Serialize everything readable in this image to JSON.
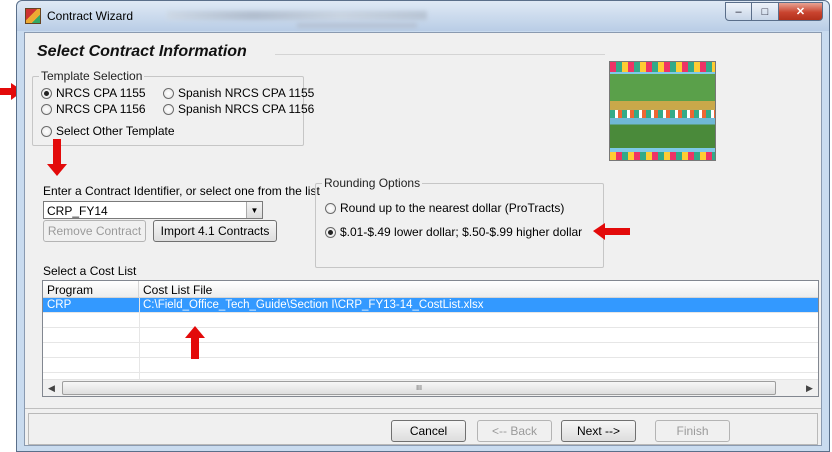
{
  "window": {
    "title": "Contract Wizard",
    "buttons": {
      "minimize": "–",
      "maximize": "□",
      "close": "✕"
    }
  },
  "page": {
    "heading": "Select Contract Information"
  },
  "template_selection": {
    "legend": "Template Selection",
    "options": [
      {
        "label": "NRCS CPA 1155",
        "selected": true
      },
      {
        "label": "Spanish NRCS CPA 1155",
        "selected": false
      },
      {
        "label": "NRCS CPA 1156",
        "selected": false
      },
      {
        "label": "Spanish NRCS CPA 1156",
        "selected": false
      },
      {
        "label": "Select Other Template",
        "selected": false
      }
    ]
  },
  "contract": {
    "prompt": "Enter a Contract Identifier, or select one from the list",
    "value": "CRP_FY14",
    "dropdown_icon": "chevron-down-icon",
    "remove_label": "Remove Contract",
    "import_label": "Import 4.1 Contracts"
  },
  "rounding": {
    "legend": "Rounding Options",
    "options": [
      {
        "label": "Round up to the nearest dollar (ProTracts)",
        "selected": false
      },
      {
        "label": "$.01-$.49 lower dollar; $.50-$.99 higher dollar",
        "selected": true
      }
    ]
  },
  "cost_list": {
    "label": "Select a Cost List",
    "columns": [
      "Program",
      "Cost List File"
    ],
    "rows": [
      {
        "program": "CRP",
        "file": "C:\\Field_Office_Tech_Guide\\Section I\\CRP_FY13-14_CostList.xlsx",
        "selected": true
      }
    ],
    "scroll_thumb": "III"
  },
  "footer": {
    "cancel": "Cancel",
    "back": "<-- Back",
    "next": "Next -->",
    "finish": "Finish"
  },
  "colors": {
    "selection": "#3399ff",
    "annotation_arrow": "#e30a0a",
    "window_frame": "#c9dbef"
  }
}
